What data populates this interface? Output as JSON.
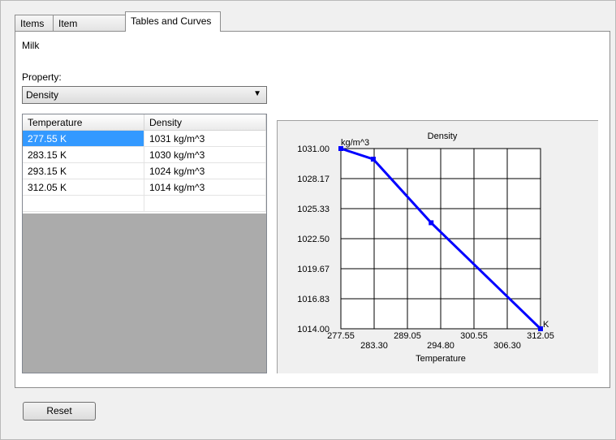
{
  "tabs": [
    {
      "label": "Items"
    },
    {
      "label": "Item Properties"
    },
    {
      "label": "Tables and Curves"
    }
  ],
  "item_name": "Milk",
  "property": {
    "label": "Property:",
    "selected": "Density"
  },
  "table": {
    "headers": [
      "Temperature",
      "Density"
    ],
    "rows": [
      [
        "277.55 K",
        "1031 kg/m^3"
      ],
      [
        "283.15 K",
        "1030 kg/m^3"
      ],
      [
        "293.15 K",
        "1024 kg/m^3"
      ],
      [
        "312.05 K",
        "1014 kg/m^3"
      ]
    ]
  },
  "reset_label": "Reset",
  "chart_data": {
    "type": "line",
    "title": "Density",
    "xlabel": "Temperature",
    "ylabel": "kg/m^3",
    "x_unit": "K",
    "x": [
      277.55,
      283.15,
      293.15,
      312.05
    ],
    "y": [
      1031,
      1030,
      1024,
      1014
    ],
    "xlim": [
      277.55,
      312.05
    ],
    "ylim": [
      1014.0,
      1031.0
    ],
    "x_ticks_upper": [
      "277.55",
      "289.05",
      "300.55",
      "312.05"
    ],
    "x_ticks_lower": [
      "283.30",
      "294.80",
      "306.30"
    ],
    "y_ticks": [
      "1031.00",
      "1028.17",
      "1025.33",
      "1022.50",
      "1019.67",
      "1016.83",
      "1014.00"
    ],
    "grid": true,
    "line_color": "#0000ff"
  }
}
